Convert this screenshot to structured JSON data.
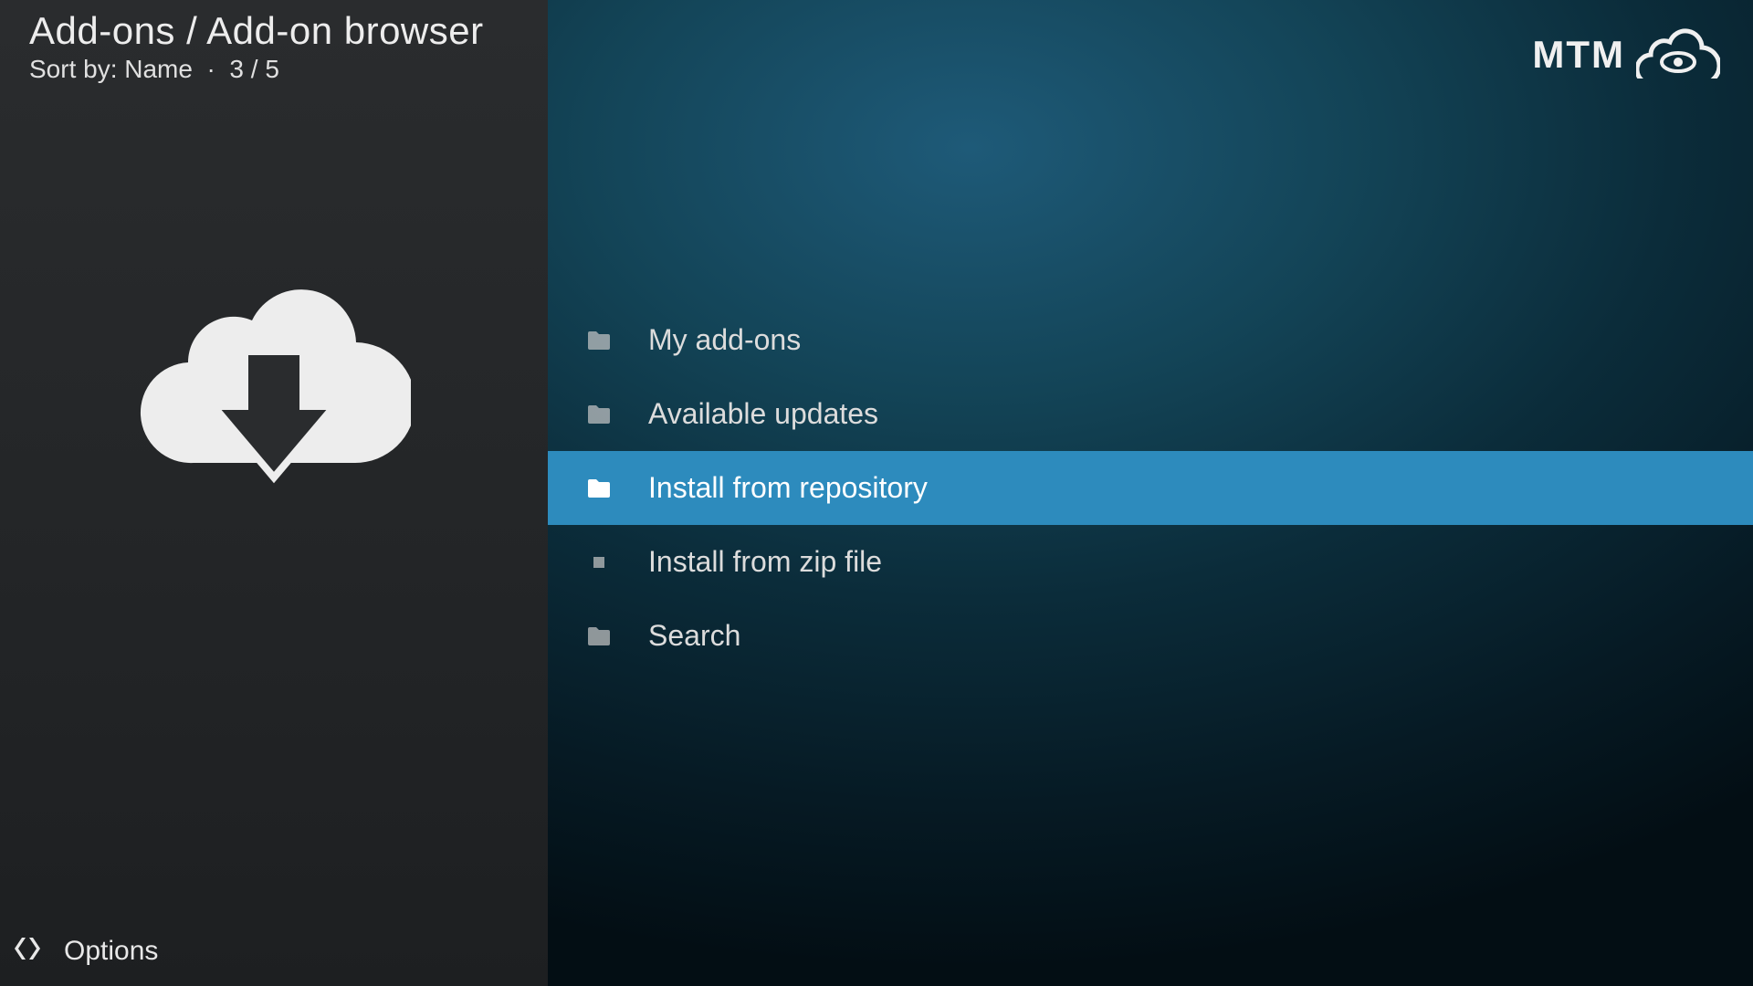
{
  "header": {
    "breadcrumb": "Add-ons / Add-on browser",
    "sort_label": "Sort by: Name",
    "separator": "·",
    "position": "3 / 5"
  },
  "logo": {
    "text": "MTM"
  },
  "menu": {
    "items": [
      {
        "label": "My add-ons",
        "icon": "folder",
        "selected": false
      },
      {
        "label": "Available updates",
        "icon": "folder",
        "selected": false
      },
      {
        "label": "Install from repository",
        "icon": "folder",
        "selected": true
      },
      {
        "label": "Install from zip file",
        "icon": "file",
        "selected": false
      },
      {
        "label": "Search",
        "icon": "folder",
        "selected": false
      }
    ]
  },
  "footer": {
    "options_label": "Options"
  }
}
